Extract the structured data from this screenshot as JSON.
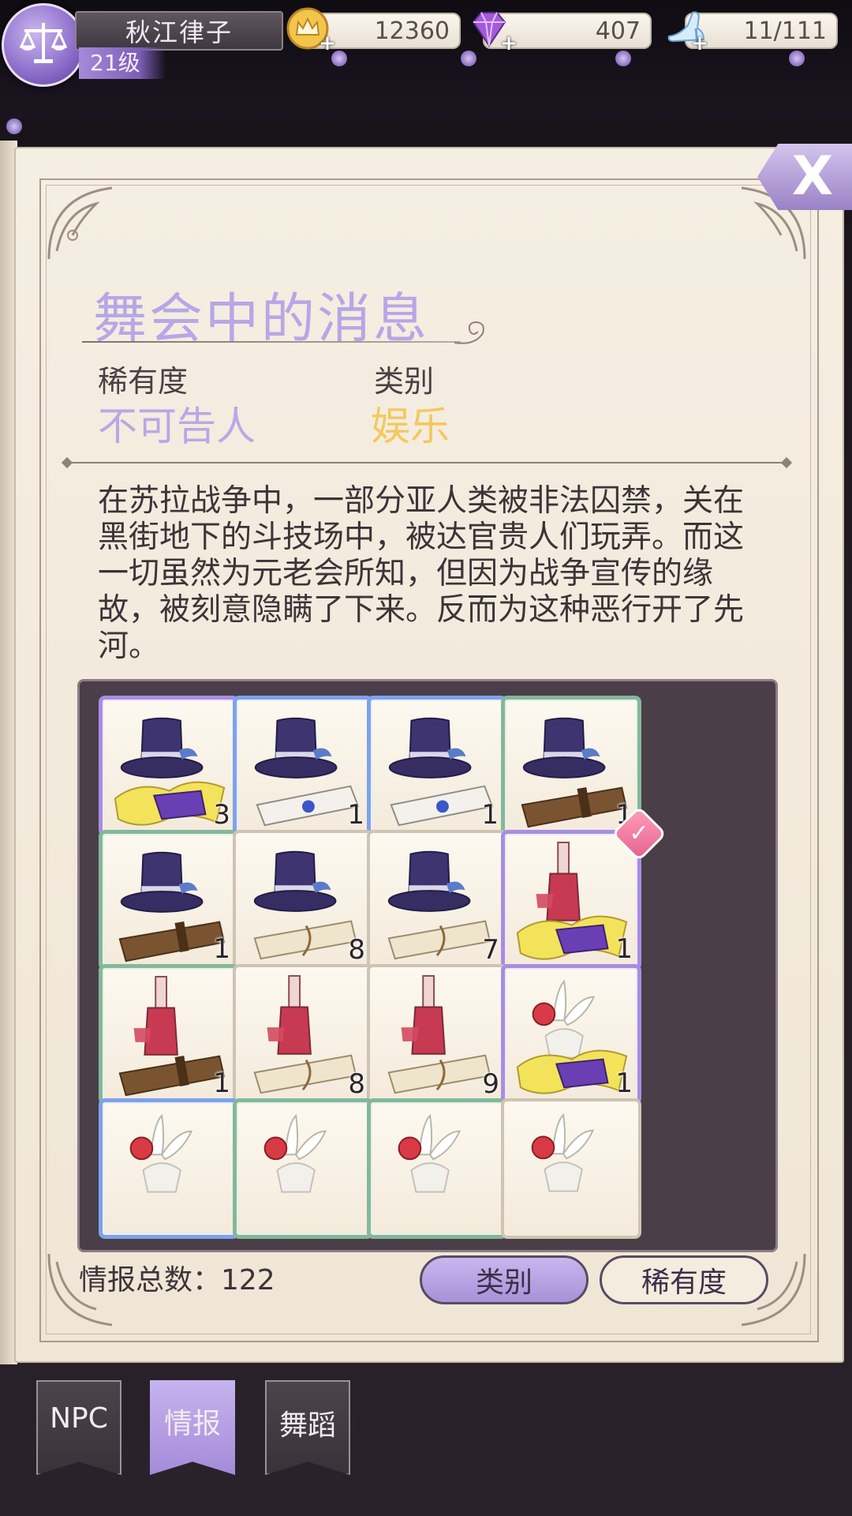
{
  "player": {
    "name": "秋江律子",
    "level": "21级"
  },
  "resources": {
    "gold": "12360",
    "gems": "407",
    "stamina": "11/111"
  },
  "close_label": "X",
  "intel": {
    "title": "舞会中的消息",
    "rarity_label": "稀有度",
    "rarity_value": "不可告人",
    "category_label": "类别",
    "category_value": "娱乐",
    "description": "在苏拉战争中，一部分亚人类被非法囚禁，关在黑街地下的斗技场中，被达官贵人们玩弄。而这一切虽然为元老会所知，但因为战争宣传的缘故，被刻意隐瞒了下来。反而为这种恶行开了先河。"
  },
  "items": [
    {
      "icon": "top-hat-with-yellow-cloth",
      "count": "3",
      "frame": "purple"
    },
    {
      "icon": "top-hat-with-white-scroll",
      "count": "1",
      "frame": "blue"
    },
    {
      "icon": "top-hat-with-white-scroll",
      "count": "1",
      "frame": "blue"
    },
    {
      "icon": "top-hat-with-brown-scroll",
      "count": "1",
      "frame": "green"
    },
    {
      "icon": "top-hat-with-brown-scroll",
      "count": "1",
      "frame": "green"
    },
    {
      "icon": "top-hat-with-parchment",
      "count": "8",
      "frame": "plain"
    },
    {
      "icon": "top-hat-with-parchment",
      "count": "7",
      "frame": "plain"
    },
    {
      "icon": "wine-bottle-with-yellow-cloth",
      "count": "1",
      "frame": "purple",
      "selected": true
    },
    {
      "icon": "wine-bottle-with-brown-scroll",
      "count": "1",
      "frame": "green"
    },
    {
      "icon": "wine-bottle-with-parchment",
      "count": "8",
      "frame": "plain"
    },
    {
      "icon": "wine-bottle-with-parchment",
      "count": "9",
      "frame": "plain"
    },
    {
      "icon": "lily-vase-with-yellow-cloth",
      "count": "1",
      "frame": "purple"
    },
    {
      "icon": "lily-vase-with-rose",
      "count": "",
      "frame": "blue"
    },
    {
      "icon": "lily-vase-with-rose",
      "count": "",
      "frame": "green"
    },
    {
      "icon": "lily-vase-with-rose",
      "count": "",
      "frame": "green"
    },
    {
      "icon": "lily-vase-with-rose",
      "count": "",
      "frame": "plain"
    }
  ],
  "footer": {
    "total": "情报总数：122",
    "sort_category": "类别",
    "sort_rarity": "稀有度"
  },
  "tabs": [
    {
      "label": "NPC"
    },
    {
      "label": "情报"
    },
    {
      "label": "舞蹈"
    }
  ]
}
